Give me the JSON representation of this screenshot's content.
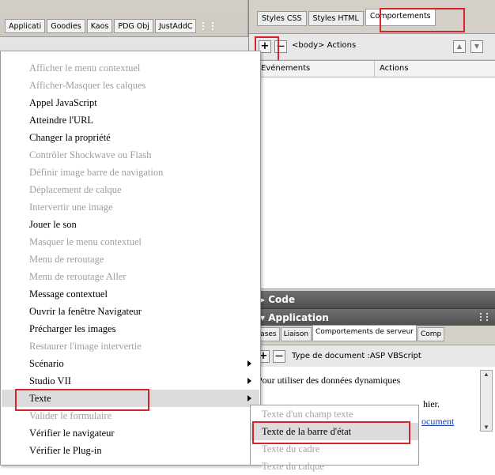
{
  "left_panel": {
    "tabs": [
      "Applicati",
      "Goodies",
      "Kaos",
      "PDG Obj",
      "JustAddC"
    ]
  },
  "context_menu": {
    "items": [
      {
        "label": "Afficher le menu contextuel",
        "disabled": true
      },
      {
        "label": "Afficher-Masquer les calques",
        "disabled": true
      },
      {
        "label": "Appel JavaScript",
        "disabled": false
      },
      {
        "label": "Atteindre l'URL",
        "disabled": false
      },
      {
        "label": "Changer la propriété",
        "disabled": false
      },
      {
        "label": "Contrôler Shockwave ou Flash",
        "disabled": true
      },
      {
        "label": "Définir image barre de navigation",
        "disabled": true
      },
      {
        "label": "Déplacement de calque",
        "disabled": true
      },
      {
        "label": "Intervertir une image",
        "disabled": true
      },
      {
        "label": "Jouer le son",
        "disabled": false
      },
      {
        "label": "Masquer le menu contextuel",
        "disabled": true
      },
      {
        "label": "Menu de reroutage",
        "disabled": true
      },
      {
        "label": "Menu de reroutage Aller",
        "disabled": true
      },
      {
        "label": "Message contextuel",
        "disabled": false
      },
      {
        "label": "Ouvrir la fenêtre Navigateur",
        "disabled": false
      },
      {
        "label": "Précharger les images",
        "disabled": false
      },
      {
        "label": "Restaurer l'image intervertie",
        "disabled": true
      },
      {
        "label": "Scénario",
        "disabled": false,
        "submenu": true
      },
      {
        "label": "Studio VII",
        "disabled": false,
        "submenu": true
      },
      {
        "label": "Texte",
        "disabled": false,
        "submenu": true,
        "highlighted": true
      },
      {
        "label": "Valider le formulaire",
        "disabled": true
      },
      {
        "label": "Vérifier le navigateur",
        "disabled": false
      },
      {
        "label": "Vérifier le Plug-in",
        "disabled": false
      }
    ]
  },
  "submenu": {
    "items": [
      {
        "label": "Texte d'un champ texte",
        "disabled": true
      },
      {
        "label": "Texte de la barre d'état",
        "disabled": false,
        "highlighted": true
      },
      {
        "label": "Texte du cadre",
        "disabled": true
      },
      {
        "label": "Texte du calque",
        "disabled": true
      }
    ]
  },
  "css_panel": {
    "tabs": [
      "Styles CSS",
      "Styles HTML",
      "Comportements"
    ],
    "active_tab": "Comportements",
    "add_button": "+",
    "remove_button": "—",
    "target": "<body> Actions",
    "col_events": "Evénements",
    "col_actions": "Actions"
  },
  "code_section": {
    "title": "▸ Code"
  },
  "application_section": {
    "title": "▾ Application",
    "tabs": [
      "Bases",
      "Liaison",
      "Comportements de serveur",
      "Comp"
    ],
    "active_tab": "Comportements de serveur",
    "add_button": "+",
    "remove_button": "—",
    "doc_type": "Type de document :ASP VBScript",
    "content_line1": "Pour utiliser des données dynamiques",
    "content_line2_tail": "hier.",
    "content_link_tail": "ocument"
  },
  "colors": {
    "annotation_red": "#d9232b",
    "disabled_text": "#9e9e9e",
    "highlight": "#dcdcdc"
  }
}
